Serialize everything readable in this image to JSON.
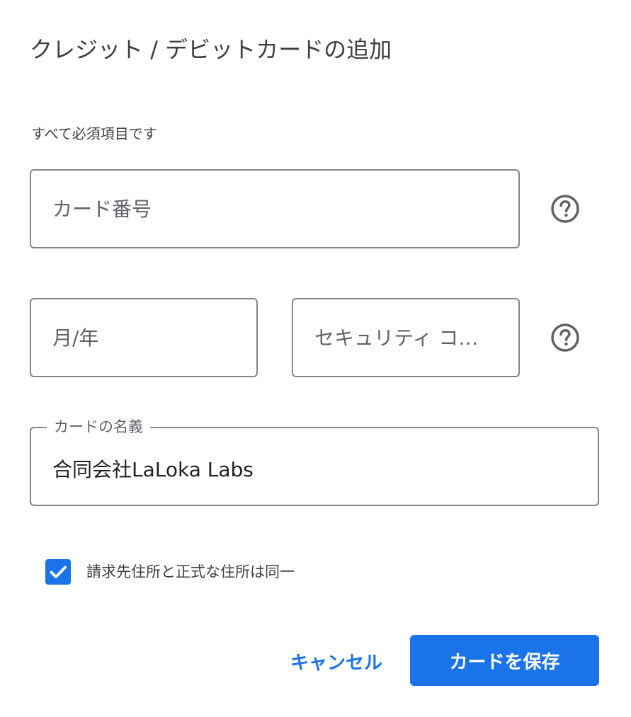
{
  "dialog": {
    "title": "クレジット / デビットカードの追加",
    "required_note": "すべて必須項目です"
  },
  "form": {
    "card_number": {
      "placeholder": "カード番号",
      "help_icon": "help-circle-icon"
    },
    "expiry": {
      "placeholder": "月/年"
    },
    "security_code": {
      "placeholder": "セキュリティ コード",
      "help_icon": "help-circle-icon"
    },
    "cardholder": {
      "label": "カードの名義",
      "value": "合同会社LaLoka Labs"
    },
    "same_address": {
      "label": "請求先住所と正式な住所は同一",
      "checked": true,
      "icon": "checkmark-icon"
    }
  },
  "actions": {
    "cancel_label": "キャンセル",
    "save_label": "カードを保存"
  },
  "colors": {
    "accent": "#1a73e8",
    "text": "#3c4043",
    "border": "#80868b"
  }
}
